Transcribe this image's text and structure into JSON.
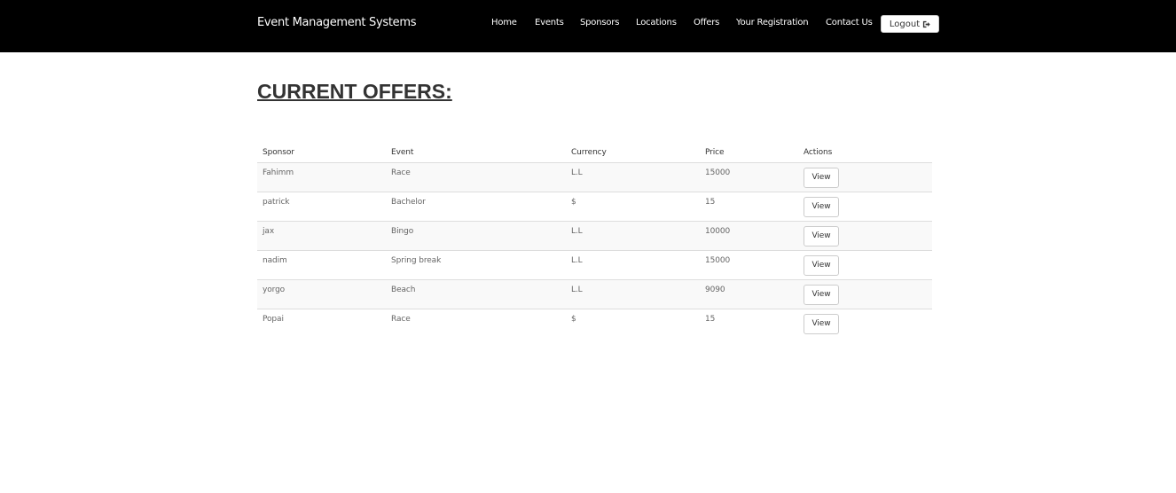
{
  "navbar": {
    "brand": "Event Management Systems",
    "links": [
      "Home",
      "Events",
      "Sponsors",
      "Locations",
      "Offers",
      "Your Registration",
      "Contact Us"
    ],
    "logout_label": "Logout",
    "logout_icon": "logout-icon"
  },
  "page": {
    "title": "CURRENT OFFERS:"
  },
  "table": {
    "headers": [
      "Sponsor",
      "Event",
      "Currency",
      "Price",
      "Actions"
    ],
    "view_label": "View",
    "rows": [
      [
        "Fahimm",
        "Race",
        "L.L",
        "15000"
      ],
      [
        "patrick",
        "Bachelor",
        "$",
        "15"
      ],
      [
        "jax",
        "Bingo",
        "L.L",
        "10000"
      ],
      [
        "nadim",
        "Spring break",
        "L.L",
        "15000"
      ],
      [
        "yorgo",
        "Beach",
        "L.L",
        "9090"
      ],
      [
        "Popai",
        "Race",
        "$",
        "15"
      ]
    ]
  }
}
